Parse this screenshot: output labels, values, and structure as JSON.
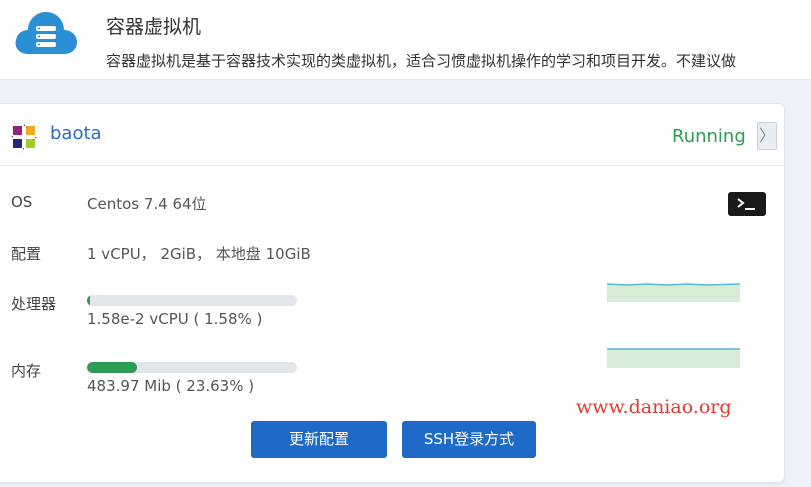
{
  "header": {
    "title": "容器虚拟机",
    "description": "容器虚拟机是基于容器技术实现的类虚拟机，适合习惯虚拟机操作的学习和项目开发。不建议做"
  },
  "vm": {
    "name": "baota",
    "status": "Running",
    "expand_glyph": "〉",
    "os_label": "OS",
    "os_value": "Centos 7.4 64位",
    "config_label": "配置",
    "config_value": "1 vCPU， 2GiB， 本地盘 10GiB",
    "cpu_label": "处理器",
    "cpu_value": "1.58e-2 vCPU ( 1.58% )",
    "cpu_percent": 1.58,
    "mem_label": "内存",
    "mem_value": "483.97 Mib ( 23.63% )",
    "mem_percent": 23.63
  },
  "buttons": {
    "update": "更新配置",
    "ssh": "SSH登录方式"
  },
  "watermark": "www.daniao.org",
  "colors": {
    "accent": "#1f6ac7",
    "running": "#2e9b55",
    "bar_fill": "#2e9b55",
    "spark_line": "#5ab8d6",
    "spark_area": "#d6ecd6"
  },
  "icons": {
    "app": "cloud-server-icon",
    "os": "centos-logo",
    "terminal": "terminal-icon"
  }
}
